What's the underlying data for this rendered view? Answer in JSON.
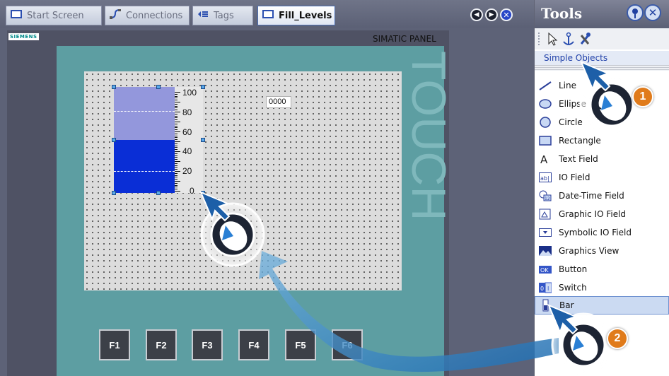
{
  "tabs": [
    {
      "label": "Start Screen",
      "icon": "screen-icon",
      "active": false
    },
    {
      "label": "Connections",
      "icon": "connections-icon",
      "active": false
    },
    {
      "label": "Tags",
      "icon": "tags-icon",
      "active": false
    },
    {
      "label": "Fill_Levels",
      "icon": "screen-icon",
      "active": true
    }
  ],
  "tab_nav": {
    "back": "nav-left-icon",
    "forward": "nav-right-icon",
    "close": "close-icon"
  },
  "panel": {
    "brand": "SIEMENS",
    "model": "SIMATIC PANEL",
    "vertical_text": "TOUCH"
  },
  "bar_object": {
    "scale_labels": [
      "100",
      "80",
      "60",
      "40",
      "20",
      "0"
    ],
    "fill_level": 0.5,
    "colors": {
      "fill": "#0a2ed6",
      "empty": "#9397dc"
    }
  },
  "io_field": {
    "value": "0000"
  },
  "function_keys": [
    "F1",
    "F2",
    "F3",
    "F4",
    "F5",
    "F6"
  ],
  "tools": {
    "title": "Tools",
    "section": "Simple Objects",
    "items": [
      {
        "label": "Line",
        "icon": "line-icon"
      },
      {
        "label": "Ellipse",
        "icon": "ellipse-icon"
      },
      {
        "label": "Circle",
        "icon": "circle-icon"
      },
      {
        "label": "Rectangle",
        "icon": "rectangle-icon"
      },
      {
        "label": "Text Field",
        "icon": "text-field-icon"
      },
      {
        "label": "IO Field",
        "icon": "io-field-icon"
      },
      {
        "label": "Date-Time Field",
        "icon": "date-time-icon"
      },
      {
        "label": "Graphic IO Field",
        "icon": "graphic-io-icon"
      },
      {
        "label": "Symbolic IO Field",
        "icon": "symbolic-io-icon"
      },
      {
        "label": "Graphics View",
        "icon": "graphics-view-icon"
      },
      {
        "label": "Button",
        "icon": "button-icon"
      },
      {
        "label": "Switch",
        "icon": "switch-icon"
      },
      {
        "label": "Bar",
        "icon": "bar-icon",
        "selected": true
      }
    ]
  },
  "annotations": {
    "step1": "1",
    "step2": "2",
    "accent": "#e07b1b"
  }
}
